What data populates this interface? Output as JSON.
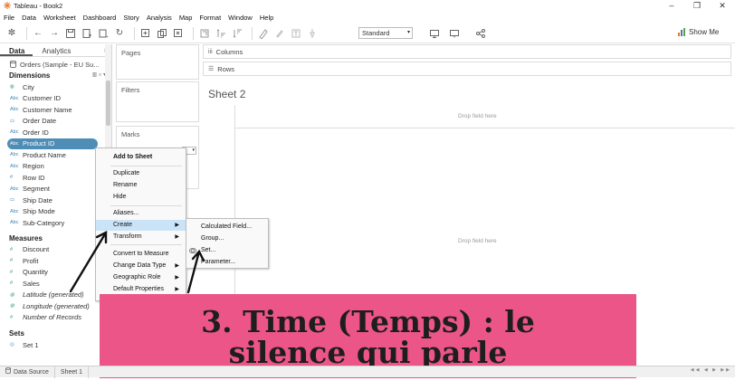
{
  "window": {
    "title": "Tableau - Book2"
  },
  "menu": [
    "File",
    "Data",
    "Worksheet",
    "Dashboard",
    "Story",
    "Analysis",
    "Map",
    "Format",
    "Window",
    "Help"
  ],
  "toolbar": {
    "fit_select": "Standard",
    "show_me": "Show Me"
  },
  "data_pane": {
    "tabs": [
      "Data",
      "Analytics"
    ],
    "source": "Orders (Sample - EU Su...",
    "dimensions_header": "Dimensions",
    "dimensions": [
      {
        "type": "geo",
        "label": "City"
      },
      {
        "type": "Abc",
        "label": "Customer ID"
      },
      {
        "type": "Abc",
        "label": "Customer Name"
      },
      {
        "type": "date",
        "label": "Order Date"
      },
      {
        "type": "Abc",
        "label": "Order ID"
      },
      {
        "type": "Abc",
        "label": "Product ID"
      },
      {
        "type": "Abc",
        "label": "Product Name"
      },
      {
        "type": "Abc",
        "label": "Region"
      },
      {
        "type": "#",
        "label": "Row ID"
      },
      {
        "type": "Abc",
        "label": "Segment"
      },
      {
        "type": "date",
        "label": "Ship Date"
      },
      {
        "type": "Abc",
        "label": "Ship Mode"
      },
      {
        "type": "Abc",
        "label": "Sub-Category"
      }
    ],
    "measures_header": "Measures",
    "measures": [
      {
        "type": "#",
        "label": "Discount"
      },
      {
        "type": "#",
        "label": "Profit"
      },
      {
        "type": "#",
        "label": "Quantity"
      },
      {
        "type": "#",
        "label": "Sales"
      },
      {
        "type": "geo",
        "label": "Latitude (generated)"
      },
      {
        "type": "geo",
        "label": "Longitude (generated)"
      },
      {
        "type": "#",
        "label": "Number of Records"
      }
    ],
    "sets_header": "Sets",
    "sets": [
      {
        "label": "Set 1"
      }
    ]
  },
  "shelves": {
    "pages": "Pages",
    "filters": "Filters",
    "marks": "Marks",
    "columns": "Columns",
    "rows": "Rows"
  },
  "sheet": {
    "title": "Sheet 2",
    "drop_top": "Drop field here",
    "drop_center": "Drop field here"
  },
  "context_menu": {
    "items": [
      "Add to Sheet",
      "Duplicate",
      "Rename",
      "Hide",
      "Aliases...",
      "Create",
      "Transform",
      "Convert to Measure",
      "Change Data Type",
      "Geographic Role",
      "Default Properties"
    ],
    "submenu": [
      "Calculated Field...",
      "Group...",
      "Set...",
      "Parameter..."
    ]
  },
  "bottom_tabs": {
    "data_source": "Data Source",
    "sheet1": "Sheet 1"
  },
  "banner": {
    "line1": "3. Time (Temps) : le",
    "line2": "silence qui parle",
    "bg_color": "#eb5587"
  }
}
